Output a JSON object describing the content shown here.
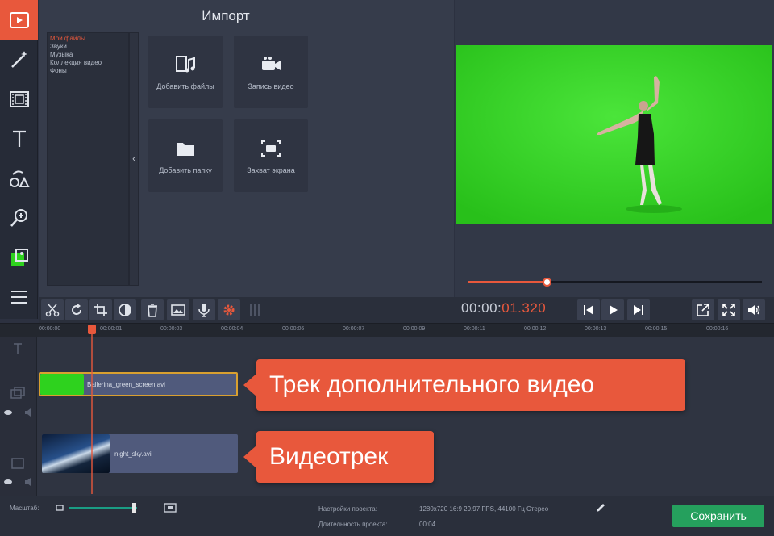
{
  "app": {
    "accent": "#e8583c",
    "save_color": "#25a05d"
  },
  "left_toolbar": [
    {
      "name": "media-import-icon",
      "active": true
    },
    {
      "name": "magic-wand-icon"
    },
    {
      "name": "film-clip-icon"
    },
    {
      "name": "text-icon"
    },
    {
      "name": "shapes-icon"
    },
    {
      "name": "zoom-icon"
    },
    {
      "name": "chroma-key-icon"
    },
    {
      "name": "more-menu-icon"
    }
  ],
  "import_panel": {
    "title": "Импорт",
    "categories": [
      "Мои файлы",
      "Звуки",
      "Музыка",
      "Коллекция видео",
      "Фоны"
    ],
    "tiles": {
      "add_files": "Добавить файлы",
      "record_video": "Запись видео",
      "add_folder": "Добавить папку",
      "screen_capture": "Захват экрана"
    }
  },
  "player": {
    "progress": 0.27,
    "timecode_main": "00:00:",
    "timecode_accent": "01.320"
  },
  "timeline": {
    "ticks": [
      "00:00:00",
      "00:00:01",
      "00:00:03",
      "00:00:04",
      "00:00:06",
      "00:00:07",
      "00:00:09",
      "00:00:11",
      "00:00:12",
      "00:00:13",
      "00:00:15",
      "00:00:16"
    ],
    "clips": {
      "overlay": "Ballerina_green_screen.avi",
      "main": "night_sky.avi"
    },
    "callouts": {
      "overlay_track": "Трек дополнительного видео",
      "video_track": "Видеотрек"
    }
  },
  "bottom": {
    "zoom_label": "Масштаб:",
    "project_settings_label": "Настройки проекта:",
    "project_settings_value": "1280x720 16:9 29.97 FPS, 44100 Гц Стерео",
    "duration_label": "Длительность проекта:",
    "duration_value": "00:04",
    "save_label": "Сохранить",
    "zoom_level": 0.95
  }
}
